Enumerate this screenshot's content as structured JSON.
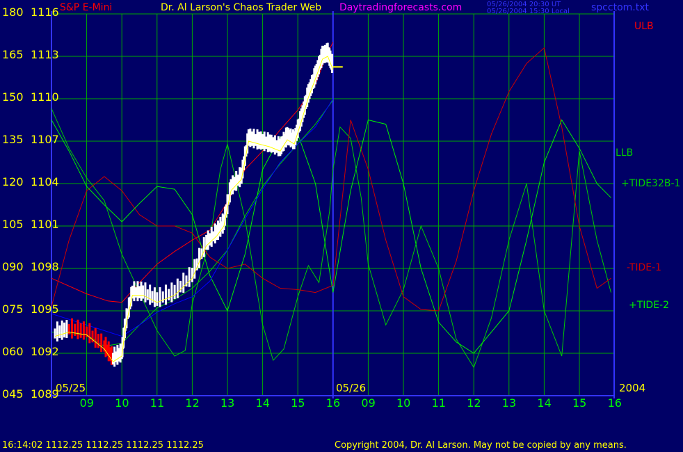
{
  "header": {
    "instrument": "S&P E-Mini",
    "title": "Dr. Al Larson's Chaos Trader Web",
    "site": "Daytradingforecasts.com",
    "time_ut": "05/26/2004 20:30 UT",
    "time_local": "05/26/2004 15:30 Local",
    "file": "spcctom.txt"
  },
  "footer": {
    "quote": "16:14:02  1112.25 1112.25 1112.25 1112.25",
    "copyright": "Copyright 2004, Dr. Al Larson. May not be copied by any means."
  },
  "colors": {
    "background": "#000066",
    "grid": "#00aa00",
    "axis": "#3333ff",
    "price_up": "#ffffff",
    "price_down": "#ff0000",
    "moving_avg": "#ffff00",
    "ulb": "#ff0000",
    "llb": "#00cc00",
    "tide32b1": "#00cc00",
    "tide1": "#cc0000",
    "tide2": "#00ee00",
    "blue_band": "#0000ff",
    "label_yellow": "#ffff00",
    "label_green": "#00ff00",
    "label_magenta": "#ff00ff"
  },
  "chart_data": {
    "type": "line",
    "title": "S&P E-Mini",
    "y_left_ticks": [
      "180",
      "165",
      "150",
      "135",
      "120",
      "105",
      "090",
      "075",
      "060",
      "045"
    ],
    "y_price_ticks": [
      "1116",
      "1113",
      "1110",
      "1107",
      "1104",
      "1101",
      "1098",
      "1095",
      "1092",
      "1089"
    ],
    "ylim": [
      1089,
      1116
    ],
    "x_hour_ticks": [
      "09",
      "10",
      "11",
      "12",
      "13",
      "14",
      "15",
      "16",
      "09",
      "10",
      "11",
      "12",
      "13",
      "14",
      "15",
      "16"
    ],
    "x_date_labels": [
      "05/25",
      "05/26"
    ],
    "year_label": "2004",
    "series_labels": [
      "ULB",
      "LLB",
      "+TIDE32B-1",
      "-TIDE-1",
      "+TIDE-2"
    ],
    "series": [
      {
        "name": "S&P E-Mini",
        "x": [
          8.1,
          8.5,
          9.0,
          9.5,
          9.75,
          10.0,
          10.1,
          10.3,
          10.6,
          11.0,
          11.5,
          12.0,
          12.4,
          12.7,
          12.9,
          13.1,
          13.4,
          13.6,
          13.9,
          14.2,
          14.5,
          14.7,
          14.9,
          15.1,
          15.3,
          15.5,
          15.7,
          15.85,
          16.0
        ],
        "values": [
          1093.4,
          1093.7,
          1093.5,
          1092.5,
          1091.6,
          1092.0,
          1094.0,
          1096.3,
          1096.3,
          1095.8,
          1096.3,
          1097.5,
          1099.8,
          1100.5,
          1101.2,
          1103.7,
          1104.5,
          1107.2,
          1107.0,
          1106.8,
          1106.5,
          1107.3,
          1107.0,
          1108.6,
          1110.3,
          1111.6,
          1113.0,
          1113.2,
          1112.25
        ]
      },
      {
        "name": "ULB",
        "x": [
          8.0,
          9.0,
          9.6,
          10.0,
          10.5,
          11.0,
          11.5,
          12.0,
          12.5,
          13.0,
          13.5,
          14.0,
          14.5,
          15.0,
          15.5,
          15.8,
          16.0
        ],
        "values": [
          1097.3,
          1096.2,
          1095.7,
          1095.6,
          1097.0,
          1098.3,
          1099.2,
          1100.0,
          1100.7,
          1102.7,
          1105.0,
          1106.3,
          1107.8,
          1109.2,
          1111.0,
          1113.0,
          1114.0
        ]
      },
      {
        "name": "LLB",
        "x": [
          8.0,
          9.0,
          9.5,
          10.0,
          10.5,
          11.0,
          11.5,
          12.0,
          12.5,
          13.0,
          13.5,
          14.0,
          14.5,
          15.0,
          15.5,
          16.0
        ],
        "values": [
          1093.5,
          1093.3,
          1092.5,
          1092.7,
          1094.0,
          1095.2,
          1095.8,
          1096.6,
          1097.8,
          1099.3,
          1101.7,
          1103.8,
          1105.4,
          1106.8,
          1108.2,
          1109.9
        ]
      },
      {
        "name": "+TIDE32B-1",
        "x": [
          8.0,
          8.5,
          9.0,
          9.5,
          10.0,
          10.5,
          11.0,
          11.5,
          11.8,
          12.0,
          12.5,
          12.8,
          13.0,
          13.5,
          14.0,
          14.3,
          14.6,
          15.0,
          15.3,
          15.6,
          15.9,
          16.0,
          16.2,
          16.5,
          16.8,
          17.0,
          17.5,
          18.0,
          18.5,
          19.0,
          19.5,
          20.0,
          20.5,
          21.0,
          21.5,
          22.0,
          22.5,
          23.0,
          23.5,
          23.9
        ],
        "values": [
          1109.3,
          1106.5,
          1104.4,
          1102.8,
          1099.0,
          1096.3,
          1093.6,
          1091.8,
          1092.2,
          1095.5,
          1100.0,
          1105.0,
          1106.8,
          1101.5,
          1094.0,
          1091.5,
          1092.3,
          1096.0,
          1098.2,
          1097.0,
          1102.0,
          1105.0,
          1108.0,
          1107.2,
          1103.0,
          1098.3,
          1094.0,
          1096.5,
          1101.0,
          1098.0,
          1093.0,
          1091.0,
          1094.5,
          1100.0,
          1104.0,
          1095.0,
          1091.8,
          1106.3,
          1100.0,
          1096.3
        ]
      },
      {
        "name": "-TIDE-1",
        "x": [
          8.0,
          8.5,
          9.0,
          9.5,
          10.0,
          10.5,
          11.0,
          11.5,
          12.0,
          12.5,
          13.0,
          13.5,
          14.0,
          14.5,
          15.0,
          15.5,
          16.0,
          16.5,
          17.0,
          17.5,
          18.0,
          18.5,
          19.0,
          19.5,
          20.0,
          20.5,
          21.0,
          21.5,
          22.0,
          22.5,
          23.0,
          23.5,
          23.9
        ],
        "values": [
          1095.3,
          1100.0,
          1103.5,
          1104.5,
          1103.5,
          1101.8,
          1101.0,
          1101.0,
          1100.5,
          1098.8,
          1098.0,
          1098.3,
          1097.3,
          1096.6,
          1096.5,
          1096.3,
          1096.8,
          1108.5,
          1105.0,
          1100.0,
          1096.0,
          1095.1,
          1095.0,
          1098.5,
          1103.5,
          1107.5,
          1110.5,
          1112.5,
          1113.6,
          1108.0,
          1101.0,
          1096.6,
          1097.3
        ]
      },
      {
        "name": "+TIDE-2",
        "x": [
          8.0,
          8.5,
          9.0,
          9.5,
          10.0,
          10.5,
          11.0,
          11.5,
          12.0,
          12.5,
          13.0,
          13.5,
          14.0,
          14.5,
          15.0,
          15.5,
          16.0,
          16.5,
          17.0,
          17.5,
          18.0,
          18.5,
          19.0,
          19.5,
          20.0,
          20.5,
          21.0,
          21.5,
          22.0,
          22.5,
          23.0,
          23.5,
          23.9
        ],
        "values": [
          1108.5,
          1106.3,
          1103.8,
          1102.5,
          1101.3,
          1102.6,
          1103.8,
          1103.6,
          1101.8,
          1097.5,
          1095.0,
          1099.0,
          1105.0,
          1107.3,
          1107.5,
          1104.0,
          1096.3,
          1103.5,
          1108.5,
          1108.2,
          1104.0,
          1098.0,
          1094.2,
          1092.8,
          1092.0,
          1093.5,
          1095.0,
          1100.0,
          1105.5,
          1108.5,
          1106.5,
          1104.0,
          1103.0
        ]
      },
      {
        "name": "blue band",
        "x": [
          8.0,
          9.0,
          10.0,
          10.5,
          11.0,
          11.5,
          12.0,
          12.5,
          13.0,
          13.5,
          14.0,
          14.5,
          15.0,
          15.5,
          16.0
        ],
        "values": [
          1094.8,
          1094.0,
          1093.2,
          1094.0,
          1094.9,
          1095.5,
          1096.0,
          1097.1,
          1099.3,
          1101.5,
          1103.6,
          1105.5,
          1106.8,
          1108.0,
          1110.0
        ]
      }
    ]
  }
}
